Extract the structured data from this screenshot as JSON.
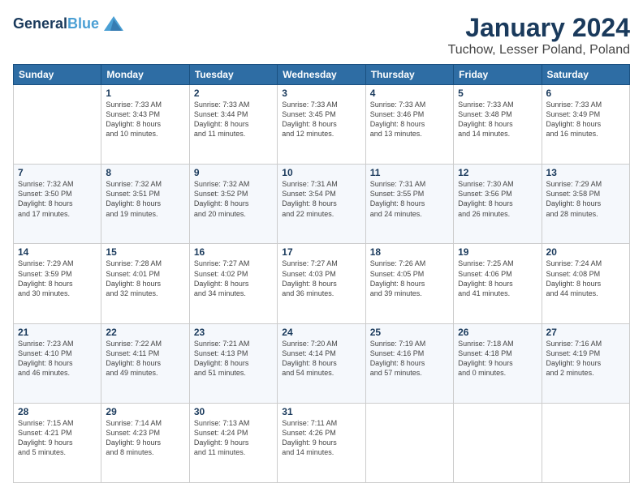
{
  "header": {
    "logo_line1": "General",
    "logo_line2": "Blue",
    "title": "January 2024",
    "subtitle": "Tuchow, Lesser Poland, Poland"
  },
  "days_of_week": [
    "Sunday",
    "Monday",
    "Tuesday",
    "Wednesday",
    "Thursday",
    "Friday",
    "Saturday"
  ],
  "weeks": [
    [
      {
        "day": "",
        "info": ""
      },
      {
        "day": "1",
        "info": "Sunrise: 7:33 AM\nSunset: 3:43 PM\nDaylight: 8 hours\nand 10 minutes."
      },
      {
        "day": "2",
        "info": "Sunrise: 7:33 AM\nSunset: 3:44 PM\nDaylight: 8 hours\nand 11 minutes."
      },
      {
        "day": "3",
        "info": "Sunrise: 7:33 AM\nSunset: 3:45 PM\nDaylight: 8 hours\nand 12 minutes."
      },
      {
        "day": "4",
        "info": "Sunrise: 7:33 AM\nSunset: 3:46 PM\nDaylight: 8 hours\nand 13 minutes."
      },
      {
        "day": "5",
        "info": "Sunrise: 7:33 AM\nSunset: 3:48 PM\nDaylight: 8 hours\nand 14 minutes."
      },
      {
        "day": "6",
        "info": "Sunrise: 7:33 AM\nSunset: 3:49 PM\nDaylight: 8 hours\nand 16 minutes."
      }
    ],
    [
      {
        "day": "7",
        "info": "Sunrise: 7:32 AM\nSunset: 3:50 PM\nDaylight: 8 hours\nand 17 minutes."
      },
      {
        "day": "8",
        "info": "Sunrise: 7:32 AM\nSunset: 3:51 PM\nDaylight: 8 hours\nand 19 minutes."
      },
      {
        "day": "9",
        "info": "Sunrise: 7:32 AM\nSunset: 3:52 PM\nDaylight: 8 hours\nand 20 minutes."
      },
      {
        "day": "10",
        "info": "Sunrise: 7:31 AM\nSunset: 3:54 PM\nDaylight: 8 hours\nand 22 minutes."
      },
      {
        "day": "11",
        "info": "Sunrise: 7:31 AM\nSunset: 3:55 PM\nDaylight: 8 hours\nand 24 minutes."
      },
      {
        "day": "12",
        "info": "Sunrise: 7:30 AM\nSunset: 3:56 PM\nDaylight: 8 hours\nand 26 minutes."
      },
      {
        "day": "13",
        "info": "Sunrise: 7:29 AM\nSunset: 3:58 PM\nDaylight: 8 hours\nand 28 minutes."
      }
    ],
    [
      {
        "day": "14",
        "info": "Sunrise: 7:29 AM\nSunset: 3:59 PM\nDaylight: 8 hours\nand 30 minutes."
      },
      {
        "day": "15",
        "info": "Sunrise: 7:28 AM\nSunset: 4:01 PM\nDaylight: 8 hours\nand 32 minutes."
      },
      {
        "day": "16",
        "info": "Sunrise: 7:27 AM\nSunset: 4:02 PM\nDaylight: 8 hours\nand 34 minutes."
      },
      {
        "day": "17",
        "info": "Sunrise: 7:27 AM\nSunset: 4:03 PM\nDaylight: 8 hours\nand 36 minutes."
      },
      {
        "day": "18",
        "info": "Sunrise: 7:26 AM\nSunset: 4:05 PM\nDaylight: 8 hours\nand 39 minutes."
      },
      {
        "day": "19",
        "info": "Sunrise: 7:25 AM\nSunset: 4:06 PM\nDaylight: 8 hours\nand 41 minutes."
      },
      {
        "day": "20",
        "info": "Sunrise: 7:24 AM\nSunset: 4:08 PM\nDaylight: 8 hours\nand 44 minutes."
      }
    ],
    [
      {
        "day": "21",
        "info": "Sunrise: 7:23 AM\nSunset: 4:10 PM\nDaylight: 8 hours\nand 46 minutes."
      },
      {
        "day": "22",
        "info": "Sunrise: 7:22 AM\nSunset: 4:11 PM\nDaylight: 8 hours\nand 49 minutes."
      },
      {
        "day": "23",
        "info": "Sunrise: 7:21 AM\nSunset: 4:13 PM\nDaylight: 8 hours\nand 51 minutes."
      },
      {
        "day": "24",
        "info": "Sunrise: 7:20 AM\nSunset: 4:14 PM\nDaylight: 8 hours\nand 54 minutes."
      },
      {
        "day": "25",
        "info": "Sunrise: 7:19 AM\nSunset: 4:16 PM\nDaylight: 8 hours\nand 57 minutes."
      },
      {
        "day": "26",
        "info": "Sunrise: 7:18 AM\nSunset: 4:18 PM\nDaylight: 9 hours\nand 0 minutes."
      },
      {
        "day": "27",
        "info": "Sunrise: 7:16 AM\nSunset: 4:19 PM\nDaylight: 9 hours\nand 2 minutes."
      }
    ],
    [
      {
        "day": "28",
        "info": "Sunrise: 7:15 AM\nSunset: 4:21 PM\nDaylight: 9 hours\nand 5 minutes."
      },
      {
        "day": "29",
        "info": "Sunrise: 7:14 AM\nSunset: 4:23 PM\nDaylight: 9 hours\nand 8 minutes."
      },
      {
        "day": "30",
        "info": "Sunrise: 7:13 AM\nSunset: 4:24 PM\nDaylight: 9 hours\nand 11 minutes."
      },
      {
        "day": "31",
        "info": "Sunrise: 7:11 AM\nSunset: 4:26 PM\nDaylight: 9 hours\nand 14 minutes."
      },
      {
        "day": "",
        "info": ""
      },
      {
        "day": "",
        "info": ""
      },
      {
        "day": "",
        "info": ""
      }
    ]
  ]
}
